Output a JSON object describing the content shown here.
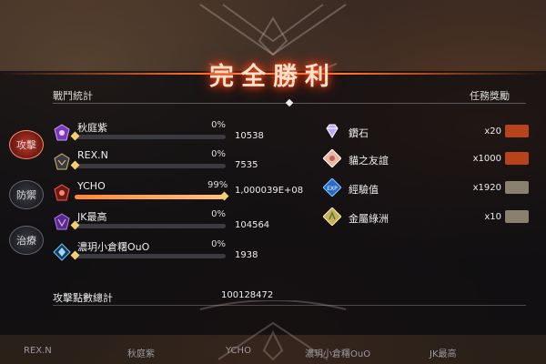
{
  "title": "完全勝利",
  "header": {
    "left": "戰鬥統計",
    "right": "任務獎勵"
  },
  "tabs": [
    {
      "label": "攻擊",
      "active": true
    },
    {
      "label": "防禦",
      "active": false
    },
    {
      "label": "治療",
      "active": false
    }
  ],
  "players": [
    {
      "name": "秋庭紫",
      "percent": "0%",
      "value": "10538",
      "progress": 0.0,
      "icon": "purple-emblem-icon"
    },
    {
      "name": "REX.N",
      "percent": "0%",
      "value": "7535",
      "progress": 0.0,
      "icon": "gold-emblem-icon"
    },
    {
      "name": "YCHO",
      "percent": "99%",
      "value": "1,000039E+08",
      "progress": 0.99,
      "icon": "red-emblem-icon"
    },
    {
      "name": "JK最高",
      "percent": "0%",
      "value": "104564",
      "progress": 0.0,
      "icon": "violet-emblem-icon"
    },
    {
      "name": "濃玥小倉糬OuO",
      "percent": "0%",
      "value": "1938",
      "progress": 0.0,
      "icon": "blue-emblem-icon"
    }
  ],
  "total": {
    "label": "攻擊點數總計",
    "value": "100128472"
  },
  "rewards": [
    {
      "name": "鑽石",
      "count": "x20",
      "badge": "",
      "badge_style": "hot",
      "icon": "diamond-icon"
    },
    {
      "name": "貓之友誼",
      "count": "x1000",
      "badge": "",
      "badge_style": "hot",
      "icon": "cat-badge-icon"
    },
    {
      "name": "經驗值",
      "count": "x1920",
      "badge": "",
      "badge_style": "grey",
      "icon": "exp-icon"
    },
    {
      "name": "金屬綠洲",
      "count": "x10",
      "badge": "",
      "badge_style": "grey",
      "icon": "metal-oasis-icon"
    }
  ],
  "bottom_bar": [
    "REX.N",
    "秋庭紫",
    "YCHO",
    "濃玥小倉糬OuO",
    "JK最高"
  ],
  "colors": {
    "accent": "#ff6a2a",
    "progress": "#ffa050",
    "active_tab": "#c23a2a"
  }
}
